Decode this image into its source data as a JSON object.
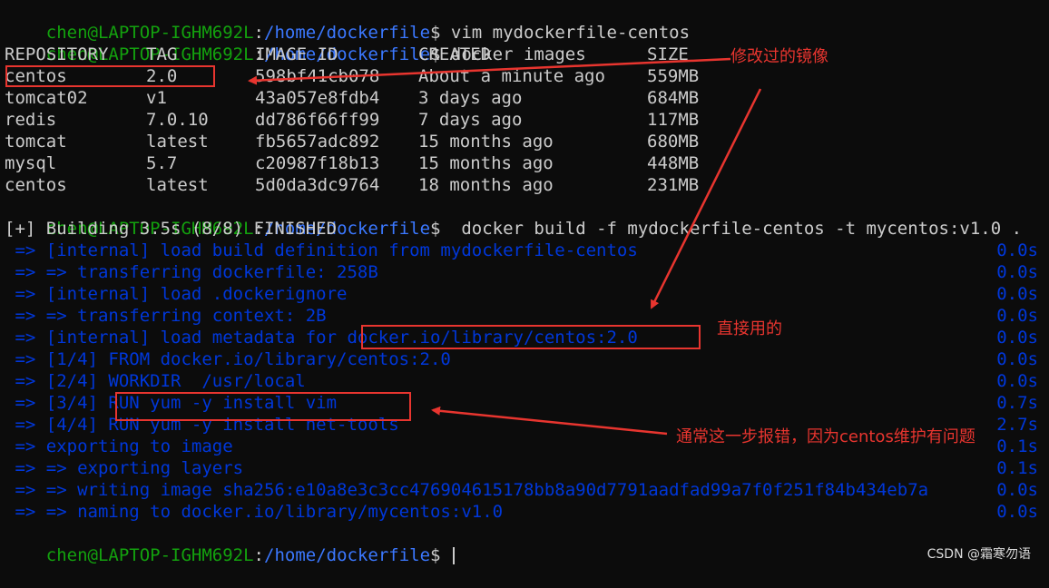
{
  "prompt": {
    "user": "chen@LAPTOP-IGHM692L",
    "colon": ":",
    "path": "/home/dockerfile",
    "dollar": "$"
  },
  "cmd1": " vim mydockerfile-centos",
  "cmd2": " docker images",
  "images": {
    "headers": [
      "REPOSITORY",
      "TAG",
      "IMAGE ID",
      "CREATED",
      "SIZE"
    ],
    "rows": [
      [
        "centos",
        "2.0",
        "598bf41cb078",
        "About a minute ago",
        "559MB"
      ],
      [
        "tomcat02",
        "v1",
        "43a057e8fdb4",
        "3 days ago",
        "684MB"
      ],
      [
        "redis",
        "7.0.10",
        "dd786f66ff99",
        "7 days ago",
        "117MB"
      ],
      [
        "tomcat",
        "latest",
        "fb5657adc892",
        "15 months ago",
        "680MB"
      ],
      [
        "mysql",
        "5.7",
        "c20987f18b13",
        "15 months ago",
        "448MB"
      ],
      [
        "centos",
        "latest",
        "5d0da3dc9764",
        "18 months ago",
        "231MB"
      ]
    ]
  },
  "cmd3": "  docker build -f mydockerfile-centos -t mycentos:v1.0 .",
  "building": "[+] Building 3.5s (8/8) FINISHED",
  "build_steps": [
    {
      "text": " => [internal] load build definition from mydockerfile-centos",
      "time": "0.0s"
    },
    {
      "text": " => => transferring dockerfile: 258B",
      "time": "0.0s"
    },
    {
      "text": " => [internal] load .dockerignore",
      "time": "0.0s"
    },
    {
      "text": " => => transferring context: 2B",
      "time": "0.0s"
    },
    {
      "text": " => [internal] load metadata for docker.io/library/centos:2.0",
      "time": "0.0s"
    },
    {
      "text": " => [1/4] FROM docker.io/library/centos:2.0",
      "time": "0.0s"
    },
    {
      "text": " => [2/4] WORKDIR  /usr/local",
      "time": "0.0s"
    },
    {
      "text": " => [3/4] RUN yum -y install vim",
      "time": "0.7s"
    },
    {
      "text": " => [4/4] RUN yum -y install net-tools",
      "time": "2.7s"
    },
    {
      "text": " => exporting to image",
      "time": "0.1s"
    },
    {
      "text": " => => exporting layers",
      "time": "0.1s"
    },
    {
      "text": " => => writing image sha256:e10a8e3c3cc476904615178bb8a90d7791aadfad99a7f0f251f84b434eb7a",
      "time": "0.0s"
    },
    {
      "text": " => => naming to docker.io/library/mycentos:v1.0",
      "time": "0.0s"
    }
  ],
  "annotations": {
    "modified_image": "修改过的镜像",
    "used_directly": "直接用的",
    "error_note": "通常这一步报错，因为centos维护有问题"
  },
  "watermark": "CSDN @霜寒勿语",
  "colors": {
    "background": "#0c0c0c",
    "user": "#13a10e",
    "path": "#3b78ff",
    "text": "#cccccc",
    "build": "#0037da",
    "annotation": "#e8352f"
  }
}
